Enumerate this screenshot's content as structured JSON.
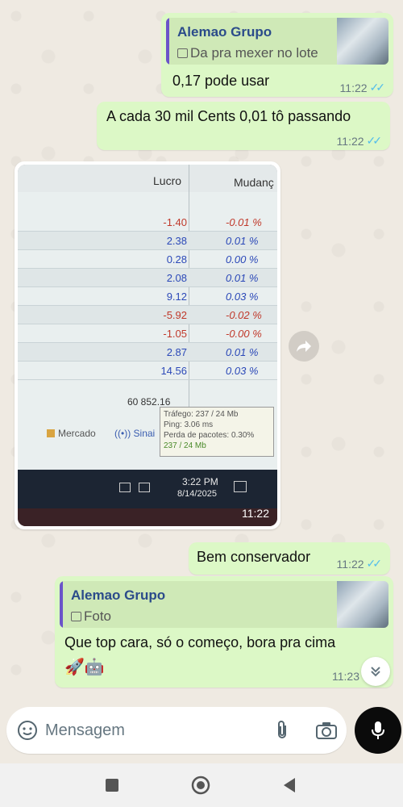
{
  "messages": {
    "m1": {
      "quote_name": "Alemao Grupo",
      "quote_text": "Da pra mexer no lote",
      "text": "0,17 pode usar",
      "time": "11:22"
    },
    "m2": {
      "text": "A cada 30 mil Cents 0,01 tô passando",
      "time": "11:22"
    },
    "photo": {
      "time": "11:22",
      "col_lucro": "Lucro",
      "col_mudanca": "Mudanç",
      "rows": [
        {
          "lucro": "-1.40",
          "mud": "-0.01 %"
        },
        {
          "lucro": "2.38",
          "mud": "0.01 %"
        },
        {
          "lucro": "0.28",
          "mud": "0.00 %"
        },
        {
          "lucro": "2.08",
          "mud": "0.01 %"
        },
        {
          "lucro": "9.12",
          "mud": "0.03 %"
        },
        {
          "lucro": "-5.92",
          "mud": "-0.02 %"
        },
        {
          "lucro": "-1.05",
          "mud": "-0.00 %"
        },
        {
          "lucro": "2.87",
          "mud": "0.01 %"
        },
        {
          "lucro": "14.56",
          "mud": "0.03 %"
        }
      ],
      "total": "60 852.16",
      "tooltip": [
        "Tráfego: 237 / 24 Mb",
        "Ping: 3.06 ms",
        "Perda de pacotes: 0.30%"
      ],
      "mercado": "Mercado",
      "sinais": "Sinai",
      "traffic": "237 / 24 Mb",
      "clock_time": "3:22 PM",
      "clock_date": "8/14/2025"
    },
    "m3": {
      "text": "Bem conservador",
      "time": "11:22"
    },
    "m4": {
      "quote_name": "Alemao Grupo",
      "quote_text": "Foto",
      "text": "Que top cara, só o começo, bora pra cima",
      "emoji": "🚀🤖",
      "time": "11:23"
    }
  },
  "composer": {
    "placeholder": "Mensagem"
  },
  "icons": {
    "sticker": "sticker-icon",
    "attach": "paperclip-icon",
    "camera": "camera-icon",
    "mic": "mic-icon",
    "forward": "forward-icon",
    "scroll": "double-chevron-down-icon",
    "nav_recent": "square-icon",
    "nav_home": "circle-icon",
    "nav_back": "triangle-back-icon"
  },
  "colors": {
    "outgoing": "#dcf8c6",
    "read_ticks": "#53bdeb",
    "quote_bar": "#6b54c9"
  }
}
